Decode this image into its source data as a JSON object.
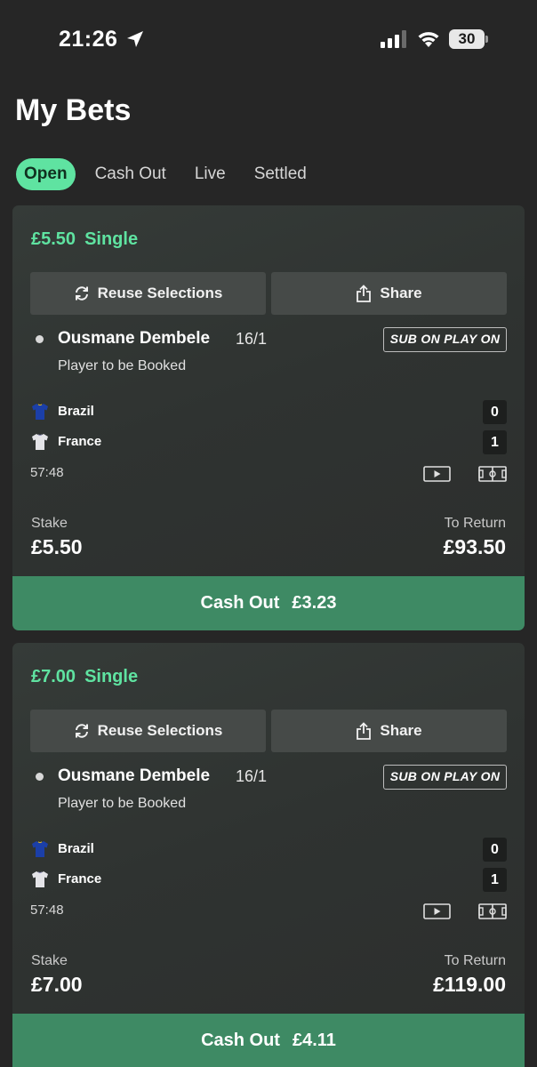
{
  "status_bar": {
    "time": "21:26",
    "battery": "30"
  },
  "page": {
    "title": "My Bets"
  },
  "tabs": [
    {
      "label": "Open",
      "active": true
    },
    {
      "label": "Cash Out",
      "active": false
    },
    {
      "label": "Live",
      "active": false
    },
    {
      "label": "Settled",
      "active": false
    }
  ],
  "bets": [
    {
      "amount": "£5.50",
      "type": "Single",
      "reuse_label": "Reuse Selections",
      "share_label": "Share",
      "selection": "Ousmane Dembele",
      "odds": "16/1",
      "badge": "SUB ON PLAY ON",
      "market": "Player to be Booked",
      "home_team": "Brazil",
      "home_score": "0",
      "away_team": "France",
      "away_score": "1",
      "clock": "57:48",
      "stake_label": "Stake",
      "stake": "£5.50",
      "return_label": "To Return",
      "to_return": "£93.50",
      "cashout_label": "Cash Out",
      "cashout_amount": "£3.23"
    },
    {
      "amount": "£7.00",
      "type": "Single",
      "reuse_label": "Reuse Selections",
      "share_label": "Share",
      "selection": "Ousmane Dembele",
      "odds": "16/1",
      "badge": "SUB ON PLAY ON",
      "market": "Player to be Booked",
      "home_team": "Brazil",
      "home_score": "0",
      "away_team": "France",
      "away_score": "1",
      "clock": "57:48",
      "stake_label": "Stake",
      "stake": "£7.00",
      "return_label": "To Return",
      "to_return": "£119.00",
      "cashout_label": "Cash Out",
      "cashout_amount": "£4.11"
    }
  ],
  "colors": {
    "accent": "#5fe3a1",
    "cashout": "#3e8a64",
    "background": "#262626",
    "card": "#313533",
    "button": "#464a48",
    "brazil_shirt": "#1b3fa8",
    "france_shirt": "#e4e4e8"
  },
  "icons": {
    "status_location": "location-arrow-icon",
    "status_signal": "cellular-signal-icon",
    "status_wifi": "wifi-icon",
    "reuse": "refresh-icon",
    "share": "share-icon",
    "video": "video-play-icon",
    "pitch": "pitch-icon"
  }
}
